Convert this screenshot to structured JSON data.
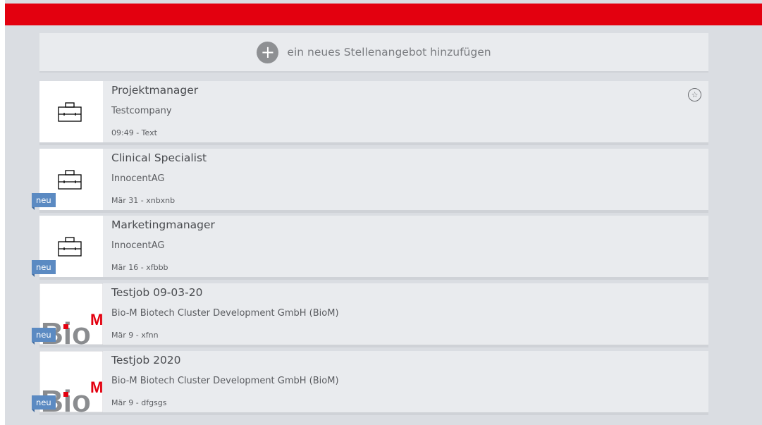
{
  "add_bar": {
    "icon": "plus-icon",
    "label": "ein neues Stellenangebot hinzufügen"
  },
  "jobs": [
    {
      "title": "Projektmanager",
      "company": "Testcompany",
      "meta": "09:49 - Text",
      "logo": "briefcase-icon",
      "badge": "",
      "starred": true
    },
    {
      "title": "Clinical Specialist",
      "company": "InnocentAG",
      "meta": "Mär 31 - xnbxnb",
      "logo": "briefcase-icon",
      "badge": "neu"
    },
    {
      "title": "Marketingmanager",
      "company": "InnocentAG",
      "meta": "Mär 16 - xfbbb",
      "logo": "briefcase-icon",
      "badge": "neu"
    },
    {
      "title": "Testjob 09-03-20",
      "company": "Bio-M Biotech Cluster Development GmbH (BioM)",
      "meta": "Mär 9 - xfnn",
      "logo": "biom-logo",
      "badge": "neu"
    },
    {
      "title": "Testjob 2020",
      "company": "Bio-M Biotech Cluster Development GmbH (BioM)",
      "meta": "Mär 9 - dfgsgs",
      "logo": "biom-logo",
      "badge": "neu"
    }
  ],
  "colors": {
    "topbar": "#e3000f",
    "badge": "#5b8ac2",
    "background": "#dadde2",
    "card": "#e9ebee"
  }
}
